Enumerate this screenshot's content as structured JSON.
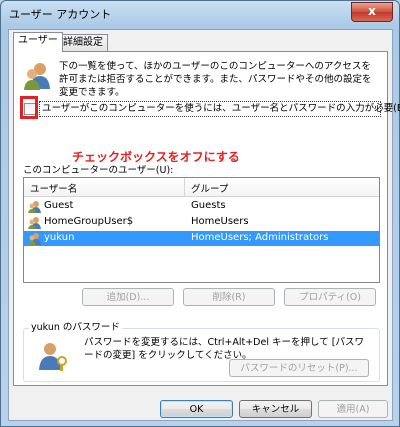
{
  "window": {
    "title": "ユーザー アカウント",
    "close_glyph": "x"
  },
  "tabs": [
    {
      "label": "ユーザー",
      "active": true
    },
    {
      "label": "詳細設定",
      "active": false
    }
  ],
  "intro_text": "下の一覧を使って、ほかのユーザーのこのコンピューターへのアクセスを許可または拒否することができます。また、パスワードやその他の設定を変更できます。",
  "require_login": {
    "label": "ユーザーがこのコンピューターを使うには、ユーザー名とパスワードの入力が必要(E)",
    "checked": false
  },
  "annotation": {
    "text": "チェックボックスをオフにする",
    "color": "#e52020"
  },
  "users_list": {
    "label": "このコンピューターのユーザー(U):",
    "columns": [
      "ユーザー名",
      "グループ"
    ],
    "rows": [
      {
        "name": "Guest",
        "group": "Guests",
        "selected": false
      },
      {
        "name": "HomeGroupUser$",
        "group": "HomeUsers",
        "selected": false
      },
      {
        "name": "yukun",
        "group": "HomeUsers; Administrators",
        "selected": true
      }
    ]
  },
  "list_buttons": {
    "add": "追加(D)...",
    "remove": "削除(R)",
    "properties": "プロパティ(O)"
  },
  "password_group": {
    "title": "yukun のパスワード",
    "text": "パスワードを変更するには、Ctrl+Alt+Del キーを押して [パスワードの変更] をクリックしてください。",
    "reset_button": "パスワードのリセット(P)..."
  },
  "footer_buttons": {
    "ok": "OK",
    "cancel": "キャンセル",
    "apply": "適用(A)"
  },
  "colors": {
    "selection": "#3399ff",
    "accent_red": "#e52020"
  }
}
